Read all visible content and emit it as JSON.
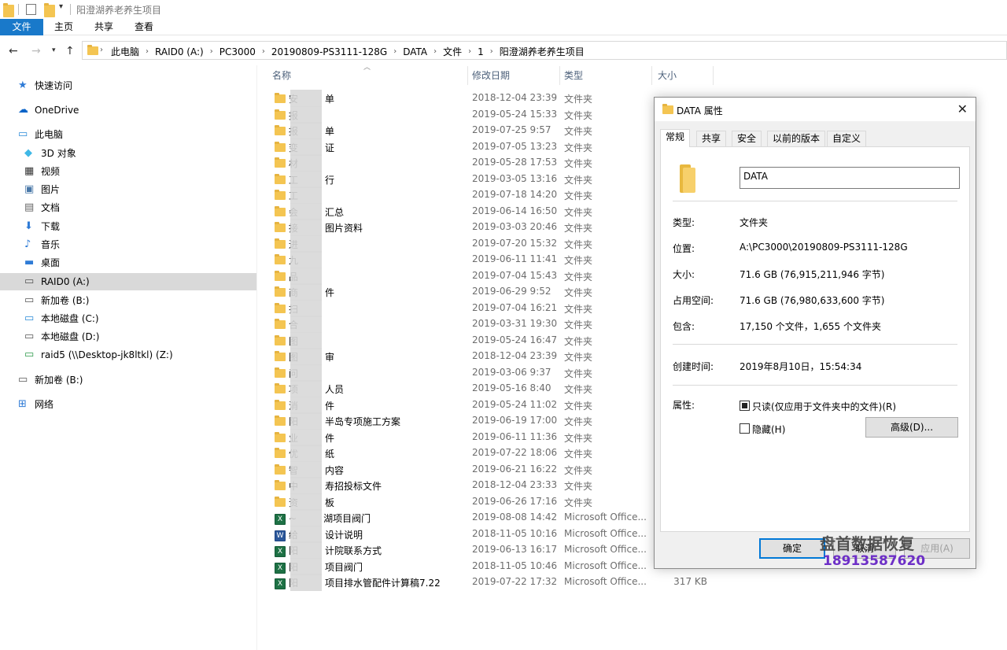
{
  "window": {
    "title": "阳澄湖养老养生项目"
  },
  "ribbon": {
    "tabs": [
      "文件",
      "主页",
      "共享",
      "查看"
    ]
  },
  "address": {
    "crumbs": [
      "此电脑",
      "RAID0 (A:)",
      "PC3000",
      "20190809-PS3111-128G",
      "DATA",
      "文件",
      "1",
      "阳澄湖养老养生项目"
    ]
  },
  "nav_pane": [
    {
      "label": "快速访问",
      "icon": "star-icon",
      "indent": 0
    },
    {
      "label": "OneDrive",
      "icon": "cloud-icon",
      "indent": 0
    },
    {
      "label": "此电脑",
      "icon": "pc-icon",
      "indent": 0
    },
    {
      "label": "3D 对象",
      "icon": "cube-icon",
      "indent": 1
    },
    {
      "label": "视频",
      "icon": "video-icon",
      "indent": 1
    },
    {
      "label": "图片",
      "icon": "picture-icon",
      "indent": 1
    },
    {
      "label": "文档",
      "icon": "document-icon",
      "indent": 1
    },
    {
      "label": "下载",
      "icon": "download-icon",
      "indent": 1
    },
    {
      "label": "音乐",
      "icon": "music-icon",
      "indent": 1
    },
    {
      "label": "桌面",
      "icon": "desktop-icon",
      "indent": 1
    },
    {
      "label": "RAID0 (A:)",
      "icon": "drive-icon",
      "indent": 1,
      "selected": true
    },
    {
      "label": "新加卷 (B:)",
      "icon": "drive-icon",
      "indent": 1
    },
    {
      "label": "本地磁盘 (C:)",
      "icon": "windows-drive-icon",
      "indent": 1
    },
    {
      "label": "本地磁盘 (D:)",
      "icon": "drive-icon",
      "indent": 1
    },
    {
      "label": "raid5 (\\\\Desktop-jk8ltkl) (Z:)",
      "icon": "network-drive-icon",
      "indent": 1
    },
    {
      "label": "新加卷 (B:)",
      "icon": "drive-icon",
      "indent": 0
    },
    {
      "label": "网络",
      "icon": "network-icon",
      "indent": 0
    }
  ],
  "columns": {
    "name": "名称",
    "date": "修改日期",
    "type": "类型",
    "size": "大小"
  },
  "files": [
    {
      "name": "安",
      "suffix": "单",
      "date": "2018-12-04 23:39",
      "type": "文件夹",
      "size": "",
      "icon": "folder"
    },
    {
      "name": "报",
      "suffix": "",
      "date": "2019-05-24 15:33",
      "type": "文件夹",
      "size": "",
      "icon": "folder"
    },
    {
      "name": "报",
      "suffix": "单",
      "date": "2019-07-25 9:57",
      "type": "文件夹",
      "size": "",
      "icon": "folder"
    },
    {
      "name": "变",
      "suffix": "证",
      "date": "2019-07-05 13:23",
      "type": "文件夹",
      "size": "",
      "icon": "folder"
    },
    {
      "name": "材",
      "suffix": "",
      "date": "2019-05-28 17:53",
      "type": "文件夹",
      "size": "",
      "icon": "folder"
    },
    {
      "name": "工",
      "suffix": "行",
      "date": "2019-03-05 13:16",
      "type": "文件夹",
      "size": "",
      "icon": "folder"
    },
    {
      "name": "工",
      "suffix": "",
      "date": "2019-07-18 14:20",
      "type": "文件夹",
      "size": "",
      "icon": "folder"
    },
    {
      "name": "会",
      "suffix": "汇总",
      "date": "2019-06-14 16:50",
      "type": "文件夹",
      "size": "",
      "icon": "folder"
    },
    {
      "name": "接",
      "suffix": "图片资料",
      "date": "2019-03-03 20:46",
      "type": "文件夹",
      "size": "",
      "icon": "folder"
    },
    {
      "name": "进",
      "suffix": "",
      "date": "2019-07-20 15:32",
      "type": "文件夹",
      "size": "",
      "icon": "folder"
    },
    {
      "name": "九",
      "suffix": "",
      "date": "2019-06-11 11:41",
      "type": "文件夹",
      "size": "",
      "icon": "folder"
    },
    {
      "name": "品",
      "suffix": "",
      "date": "2019-07-04 15:43",
      "type": "文件夹",
      "size": "",
      "icon": "folder"
    },
    {
      "name": "商",
      "suffix": "件",
      "date": "2019-06-29 9:52",
      "type": "文件夹",
      "size": "",
      "icon": "folder"
    },
    {
      "name": "扫",
      "suffix": "",
      "date": "2019-07-04 16:21",
      "type": "文件夹",
      "size": "",
      "icon": "folder"
    },
    {
      "name": "合",
      "suffix": "",
      "date": "2019-03-31 19:30",
      "type": "文件夹",
      "size": "",
      "icon": "folder"
    },
    {
      "name": "图",
      "suffix": "",
      "date": "2019-05-24 16:47",
      "type": "文件夹",
      "size": "",
      "icon": "folder"
    },
    {
      "name": "图",
      "suffix": "审",
      "date": "2018-12-04 23:39",
      "type": "文件夹",
      "size": "",
      "icon": "folder"
    },
    {
      "name": "问",
      "suffix": "",
      "date": "2019-03-06 9:37",
      "type": "文件夹",
      "size": "",
      "icon": "folder"
    },
    {
      "name": "项",
      "suffix": "人员",
      "date": "2019-05-16 8:40",
      "type": "文件夹",
      "size": "",
      "icon": "folder"
    },
    {
      "name": "消",
      "suffix": "件",
      "date": "2019-05-24 11:02",
      "type": "文件夹",
      "size": "",
      "icon": "folder"
    },
    {
      "name": "阳",
      "suffix": "半岛专项施工方案",
      "date": "2019-06-19 17:00",
      "type": "文件夹",
      "size": "",
      "icon": "folder"
    },
    {
      "name": "业",
      "suffix": "件",
      "date": "2019-06-11 11:36",
      "type": "文件夹",
      "size": "",
      "icon": "folder"
    },
    {
      "name": "优",
      "suffix": "纸",
      "date": "2019-07-22 18:06",
      "type": "文件夹",
      "size": "",
      "icon": "folder"
    },
    {
      "name": "智",
      "suffix": "内容",
      "date": "2019-06-21 16:22",
      "type": "文件夹",
      "size": "",
      "icon": "folder"
    },
    {
      "name": "中",
      "suffix": "寿招投标文件",
      "date": "2018-12-04 23:33",
      "type": "文件夹",
      "size": "",
      "icon": "folder"
    },
    {
      "name": "资",
      "suffix": "板",
      "date": "2019-06-26 17:16",
      "type": "文件夹",
      "size": "",
      "icon": "folder"
    },
    {
      "name": "~",
      "suffix": "湖项目阀门",
      "date": "2019-08-08 14:42",
      "type": "Microsoft Office...",
      "size": "",
      "icon": "xls"
    },
    {
      "name": "给",
      "suffix": "设计说明",
      "date": "2018-11-05 10:16",
      "type": "Microsoft Office...",
      "size": "",
      "icon": "doc"
    },
    {
      "name": "阳",
      "suffix": "计院联系方式",
      "date": "2019-06-13 16:17",
      "type": "Microsoft Office...",
      "size": "",
      "icon": "xls"
    },
    {
      "name": "阳",
      "suffix": "项目阀门",
      "date": "2018-11-05 10:46",
      "type": "Microsoft Office...",
      "size": "",
      "icon": "xls"
    },
    {
      "name": "阳",
      "suffix": "项目排水管配件计算稿7.22",
      "date": "2019-07-22 17:32",
      "type": "Microsoft Office...",
      "size": "317 KB",
      "icon": "xls"
    }
  ],
  "dialog": {
    "title": "DATA 属性",
    "tabs": [
      "常规",
      "共享",
      "安全",
      "以前的版本",
      "自定义"
    ],
    "name_value": "DATA",
    "props": [
      {
        "label": "类型:",
        "value": "文件夹"
      },
      {
        "label": "位置:",
        "value": "A:\\PC3000\\20190809-PS3111-128G"
      },
      {
        "label": "大小:",
        "value": "71.6 GB (76,915,211,946 字节)"
      },
      {
        "label": "占用空间:",
        "value": "71.6 GB (76,980,633,600 字节)"
      },
      {
        "label": "包含:",
        "value": "17,150 个文件，1,655 个文件夹"
      }
    ],
    "created_label": "创建时间:",
    "created_value": "2019年8月10日，15:54:34",
    "attr_label": "属性:",
    "readonly_label": "只读(仅应用于文件夹中的文件)(R)",
    "hidden_label": "隐藏(H)",
    "advanced_label": "高级(D)...",
    "ok_label": "确定",
    "cancel_label": "取消",
    "apply_label": "应用(A)"
  },
  "watermark": {
    "text": "盘首数据恢复",
    "phone": "18913587620"
  }
}
